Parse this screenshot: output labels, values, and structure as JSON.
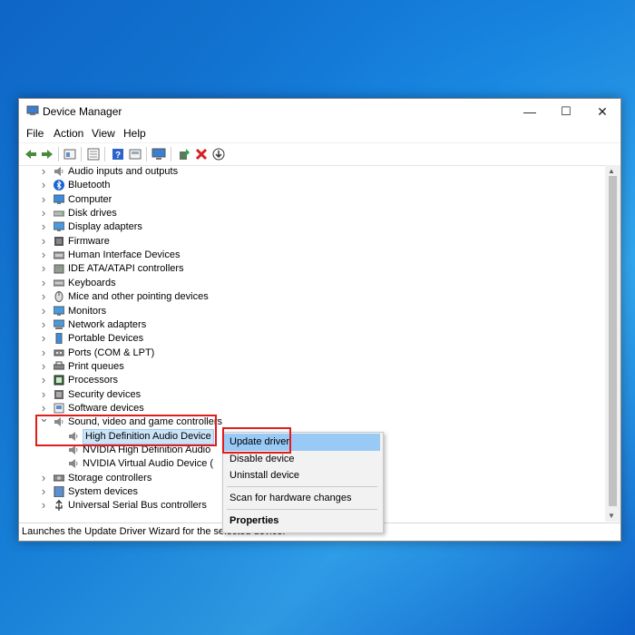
{
  "window": {
    "title": "Device Manager",
    "controls": {
      "minimize": "—",
      "maximize": "☐",
      "close": "✕"
    }
  },
  "menu": [
    "File",
    "Action",
    "View",
    "Help"
  ],
  "toolbar_icons": [
    "back-arrow-icon",
    "forward-arrow-icon",
    "properties-icon",
    "details-icon",
    "help-icon",
    "show-hidden-icon",
    "monitor-scan-icon",
    "add-driver-icon",
    "remove-device-icon",
    "download-driver-icon"
  ],
  "tree": [
    {
      "label": "Audio inputs and outputs",
      "icon": "speaker-icon",
      "expanded": false
    },
    {
      "label": "Bluetooth",
      "icon": "bluetooth-icon",
      "expanded": false
    },
    {
      "label": "Computer",
      "icon": "computer-icon",
      "expanded": false
    },
    {
      "label": "Disk drives",
      "icon": "disk-icon",
      "expanded": false
    },
    {
      "label": "Display adapters",
      "icon": "display-icon",
      "expanded": false
    },
    {
      "label": "Firmware",
      "icon": "firmware-icon",
      "expanded": false
    },
    {
      "label": "Human Interface Devices",
      "icon": "hid-icon",
      "expanded": false
    },
    {
      "label": "IDE ATA/ATAPI controllers",
      "icon": "ide-icon",
      "expanded": false
    },
    {
      "label": "Keyboards",
      "icon": "keyboard-icon",
      "expanded": false
    },
    {
      "label": "Mice and other pointing devices",
      "icon": "mouse-icon",
      "expanded": false
    },
    {
      "label": "Monitors",
      "icon": "monitor-icon",
      "expanded": false
    },
    {
      "label": "Network adapters",
      "icon": "network-icon",
      "expanded": false
    },
    {
      "label": "Portable Devices",
      "icon": "portable-icon",
      "expanded": false
    },
    {
      "label": "Ports (COM & LPT)",
      "icon": "port-icon",
      "expanded": false
    },
    {
      "label": "Print queues",
      "icon": "printer-icon",
      "expanded": false
    },
    {
      "label": "Processors",
      "icon": "processor-icon",
      "expanded": false
    },
    {
      "label": "Security devices",
      "icon": "security-icon",
      "expanded": false
    },
    {
      "label": "Software devices",
      "icon": "software-icon",
      "expanded": false
    },
    {
      "label": "Sound, video and game controllers",
      "icon": "speaker-icon",
      "expanded": true
    },
    {
      "label": "High Definition Audio Device",
      "icon": "speaker-icon",
      "child": true,
      "selected": true
    },
    {
      "label": "NVIDIA High Definition Audio",
      "icon": "speaker-icon",
      "child": true
    },
    {
      "label": "NVIDIA Virtual Audio Device (",
      "icon": "speaker-icon",
      "child": true
    },
    {
      "label": "Storage controllers",
      "icon": "storage-icon",
      "expanded": false
    },
    {
      "label": "System devices",
      "icon": "system-icon",
      "expanded": false
    },
    {
      "label": "Universal Serial Bus controllers",
      "icon": "usb-icon",
      "expanded": false
    }
  ],
  "context_menu": {
    "update_driver": "Update driver",
    "disable_device": "Disable device",
    "uninstall_device": "Uninstall device",
    "scan": "Scan for hardware changes",
    "properties": "Properties"
  },
  "status_text": "Launches the Update Driver Wizard for the selected device."
}
